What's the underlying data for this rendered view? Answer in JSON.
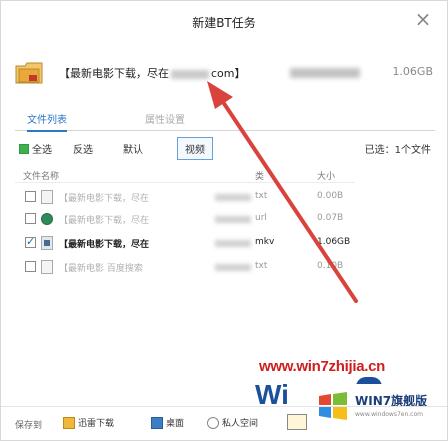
{
  "dialog": {
    "title": "新建BT任务",
    "close_label": "×"
  },
  "task": {
    "name_prefix": "【最新电影下载，尽在",
    "name_suffix": "com】",
    "size": "1.06GB"
  },
  "tabs": [
    {
      "label": "文件列表",
      "active": true
    },
    {
      "label": "属性设置",
      "active": false
    }
  ],
  "toolbar": {
    "select_all": "全选",
    "invert": "反选",
    "default": "默认",
    "video": "视频",
    "selected_count": "已选：1个文件"
  },
  "file_list": {
    "headers": {
      "name": "文件名称",
      "type": "类",
      "size": "大小"
    },
    "rows": [
      {
        "name": "【最新电影下载，尽在",
        "type": "txt",
        "size": "0.00B",
        "checked": false,
        "icon": "document-icon",
        "emphasis": false
      },
      {
        "name": "【最新电影下载，尽在",
        "type": "url",
        "size": "0.07B",
        "checked": false,
        "icon": "globe-icon",
        "emphasis": false
      },
      {
        "name": "【最新电影下载，尽在",
        "type": "mkv",
        "size": "1.06GB",
        "checked": true,
        "icon": "video-file-icon",
        "emphasis": true
      },
      {
        "name": "【最新电影 百度搜索",
        "type": "txt",
        "size": "0.10B",
        "checked": false,
        "icon": "document-icon",
        "emphasis": false
      }
    ]
  },
  "watermark": {
    "url": "www.win7zhijia.cn",
    "big_w": "Wi",
    "logo_text": "WIN7旗舰版",
    "logo_sub": "www.windows7en.com"
  },
  "bottombar": {
    "save_to": "保存到",
    "locations": [
      {
        "label": "迅雷下载",
        "icon": "thunder-folder-icon"
      },
      {
        "label": "桌面",
        "icon": "desktop-icon"
      },
      {
        "label": "私人空间",
        "icon": "cloud-icon"
      }
    ]
  },
  "colors": {
    "accent_blue": "#2a78c8",
    "arrow_red": "#d9433c",
    "watermark_red": "#d01d1d",
    "watermark_blue": "#1c4f9c"
  }
}
